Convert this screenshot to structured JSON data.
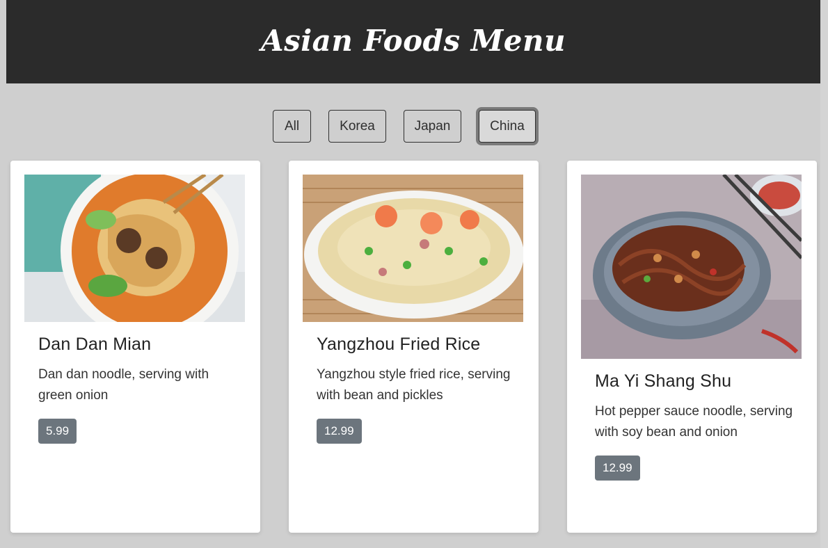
{
  "header": {
    "title": "Asian Foods Menu"
  },
  "filters": [
    {
      "label": "All",
      "active": false
    },
    {
      "label": "Korea",
      "active": false
    },
    {
      "label": "Japan",
      "active": false
    },
    {
      "label": "China",
      "active": true
    }
  ],
  "items": [
    {
      "title": "Dan Dan Mian",
      "description": "Dan dan noodle, serving with green onion",
      "price": "5.99",
      "image": "noodle-soup-bowl-photo"
    },
    {
      "title": "Yangzhou Fried Rice",
      "description": "Yangzhou style fried rice, serving with bean and pickles",
      "price": "12.99",
      "image": "fried-rice-plate-photo"
    },
    {
      "title": "Ma Yi Shang Shu",
      "description": "Hot pepper sauce noodle, serving with soy bean and onion",
      "price": "12.99",
      "image": "glass-noodle-plate-photo"
    }
  ]
}
